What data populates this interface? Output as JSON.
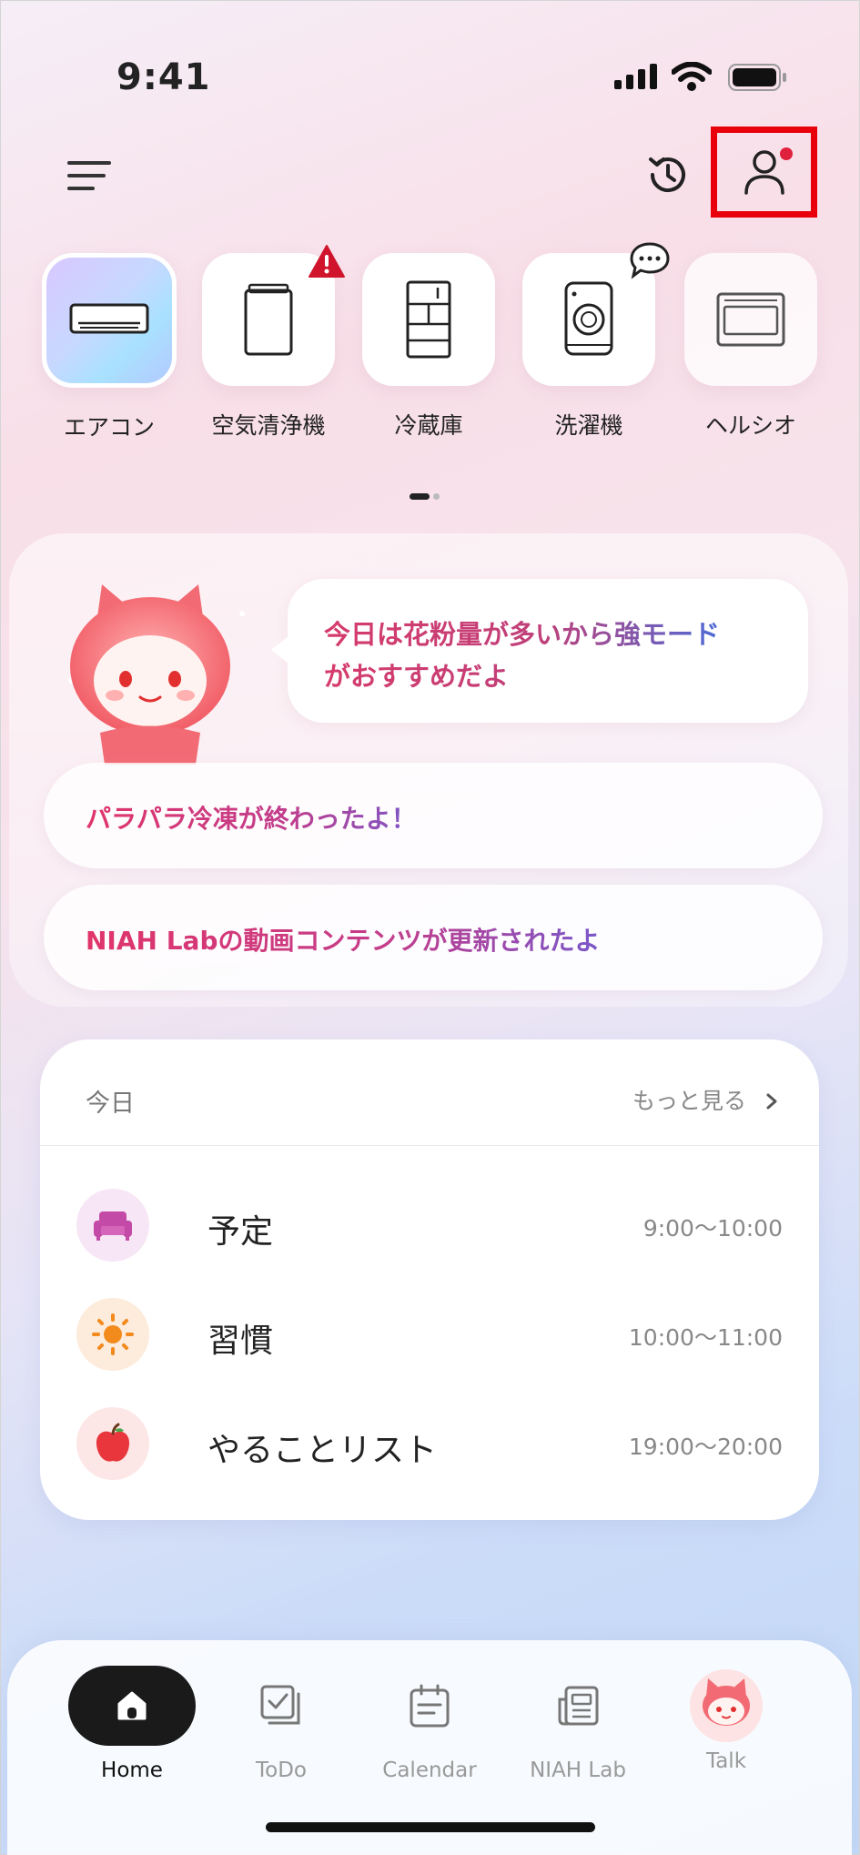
{
  "status_bar": {
    "time": "9:41"
  },
  "devices": [
    {
      "label": "エアコン",
      "icon": "air-conditioner-icon",
      "state": "selected"
    },
    {
      "label": "空気清浄機",
      "icon": "air-purifier-icon",
      "badge": "warning-icon"
    },
    {
      "label": "冷蔵庫",
      "icon": "refrigerator-icon"
    },
    {
      "label": "洗濯機",
      "icon": "washing-machine-icon",
      "badge": "chat-bubble-icon"
    },
    {
      "label": "ヘルシオ",
      "icon": "microwave-oven-icon",
      "state": "dimmed"
    }
  ],
  "pager": {
    "pages": 2,
    "current": 1
  },
  "assistant": {
    "bubble_line1": "今日は花粉量が多いから強モード",
    "bubble_line2": "がおすすめだよ",
    "notices": [
      "パラパラ冷凍が終わったよ！",
      "NIAH Labの動画コンテンツが更新されたよ"
    ]
  },
  "today": {
    "title": "今日",
    "more": "もっと見る",
    "items": [
      {
        "name": "予定",
        "time": "9:00～10:00",
        "icon": "sofa-icon",
        "color": "#f7e6f6"
      },
      {
        "name": "習慣",
        "time": "10:00～11:00",
        "icon": "sun-icon",
        "color": "#fdebdc"
      },
      {
        "name": "やることリスト",
        "time": "19:00～20:00",
        "icon": "apple-icon",
        "color": "#fde6e6"
      }
    ]
  },
  "nav": [
    {
      "label": "Home",
      "icon": "home-icon",
      "active": true
    },
    {
      "label": "ToDo",
      "icon": "todo-icon"
    },
    {
      "label": "Calendar",
      "icon": "calendar-icon"
    },
    {
      "label": "NIAH Lab",
      "icon": "newspaper-icon"
    },
    {
      "label": "Talk",
      "icon": "mascot-avatar-icon"
    }
  ],
  "colors": {
    "highlight_box": "#e8000b",
    "notification_dot": "#e0213d",
    "warning_badge": "#d0142c"
  }
}
